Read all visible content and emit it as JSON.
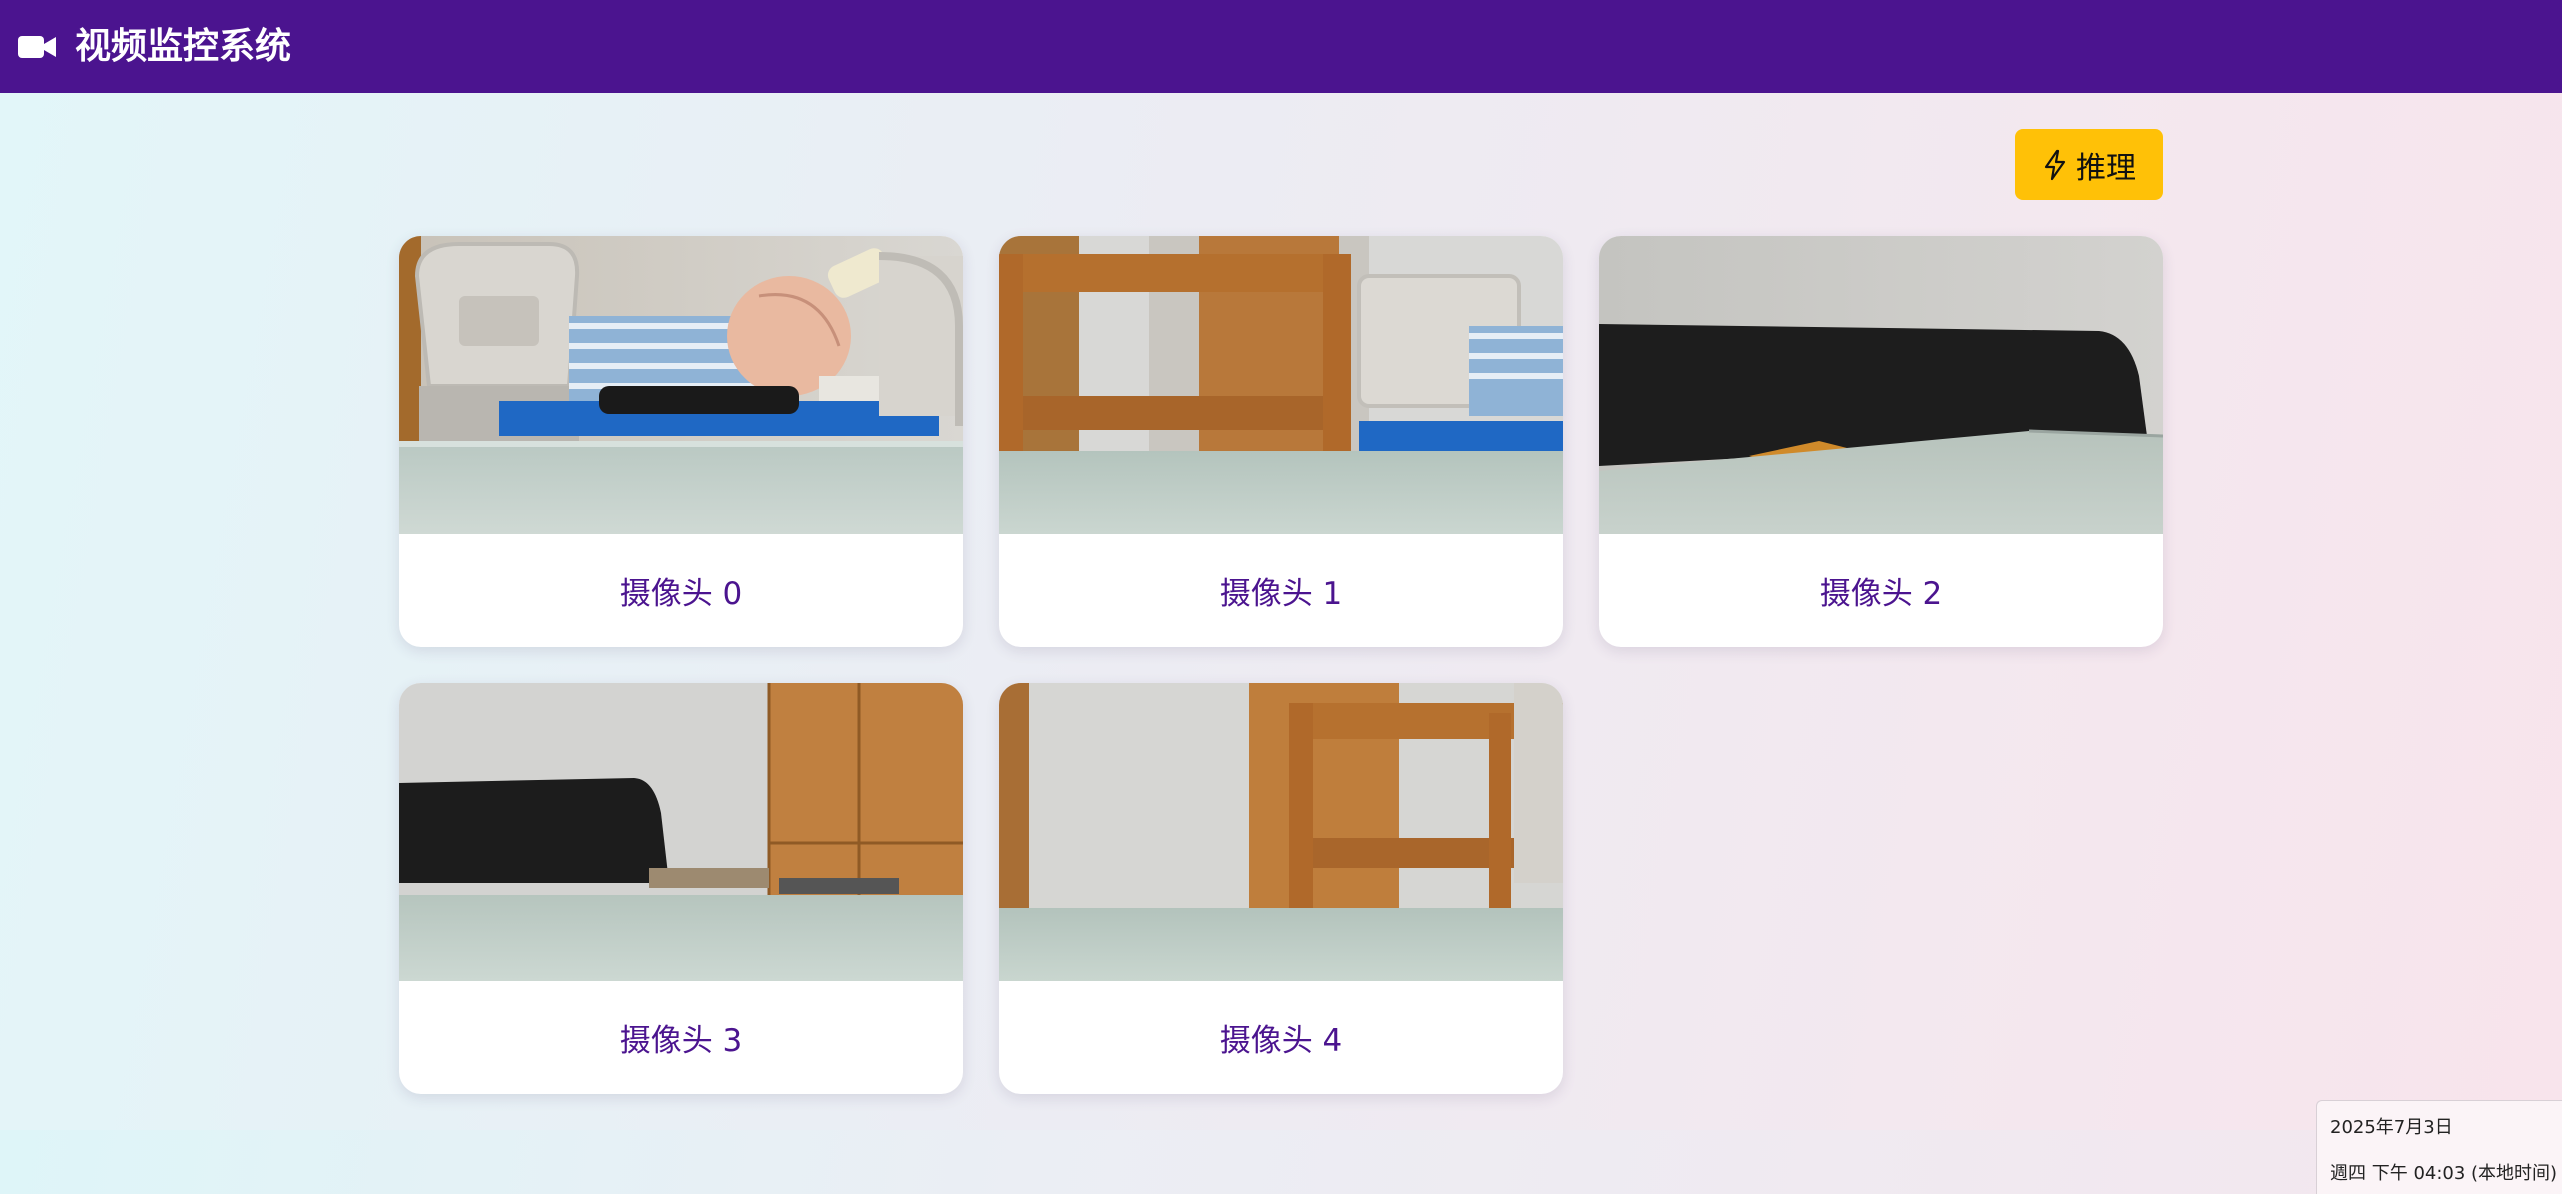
{
  "header": {
    "title": "视频监控系统",
    "icon": "video-camera-icon",
    "bg_color": "#4b148f"
  },
  "toolbar": {
    "inference_label": "推理",
    "inference_icon": "lightning-bolt-icon",
    "inference_color": "#ffc107"
  },
  "cameras": [
    {
      "label": "摄像头 0"
    },
    {
      "label": "摄像头 1"
    },
    {
      "label": "摄像头 2"
    },
    {
      "label": "摄像头 3"
    },
    {
      "label": "摄像头 4"
    }
  ],
  "clock": {
    "date": "2025年7月3日",
    "time": "週四 下午 04:03 (本地时间)"
  }
}
